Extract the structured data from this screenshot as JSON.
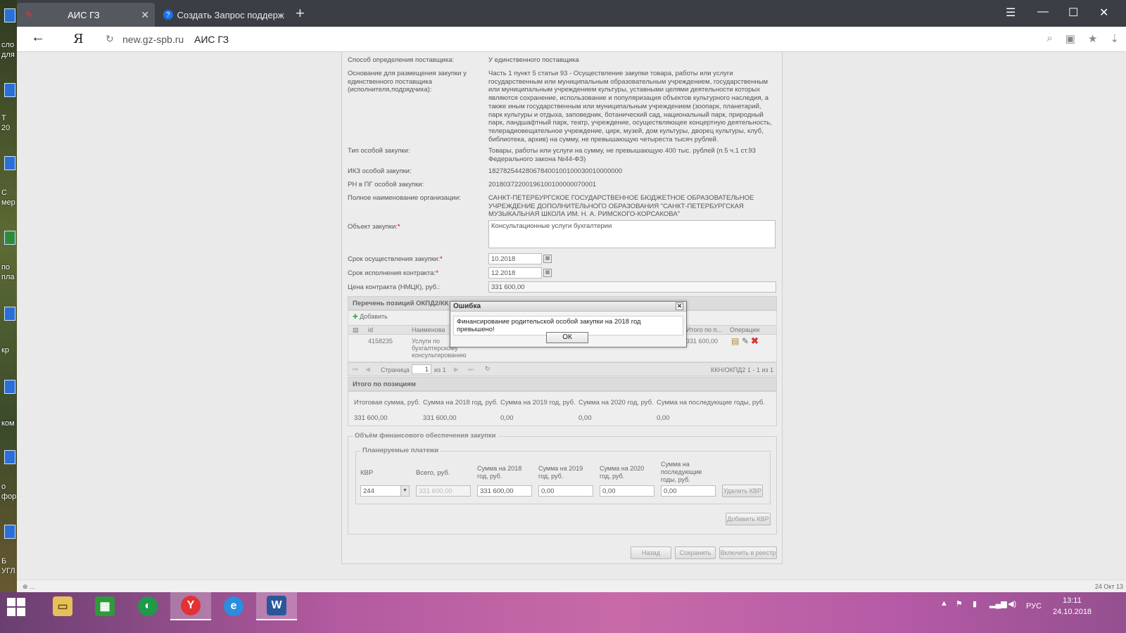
{
  "desktop": {
    "labels": [
      "сло",
      "для",
      "Т",
      "20",
      "С",
      "мер",
      "по",
      "пла",
      "кр",
      "ком",
      "о",
      "фор",
      "Б",
      "УГЛ"
    ]
  },
  "browser": {
    "tabs": [
      {
        "label": "АИС ГЗ",
        "active": true
      },
      {
        "label": "Создать Запрос поддержки",
        "active": false
      }
    ],
    "address": {
      "host": "new.gz-spb.ru",
      "title": "АИС ГЗ"
    },
    "status_left": "⊕ ...",
    "status_right": "24 Окт 13"
  },
  "form": {
    "rows": [
      {
        "label": "Способ определения поставщика:",
        "value": "У единственного поставщика"
      },
      {
        "label": "Основание для размещения закупки у единственного поставщика (исполнителя,подрядчика):",
        "value": "Часть 1 пункт 5 статьи 93 - Осуществление закупки товара, работы или услуги государственным или муниципальным образовательным учреждением, государственным или муниципальным учреждением культуры, уставными целями деятельности которых являются сохранение, использование и популяризация объектов культурного наследия, а также иным государственным или муниципальным учреждением (зоопарк, планетарий, парк культуры и отдыха, заповедник, ботанический сад, национальный парк, природный парк, ландшафтный парк, театр, учреждение, осуществляющее концертную деятельность, телерадиовещательное учреждение, цирк, музей, дом культуры, дворец культуры, клуб, библиотека, архив) на сумму, не превышающую четыреста тысяч рублей."
      },
      {
        "label": "Тип особой закупки:",
        "value": "Товары, работы или услуги на сумму, не превышающую 400 тыс. рублей (п.5 ч.1 ст.93 Федерального закона №44-ФЗ)"
      },
      {
        "label": "ИКЗ особой закупки:",
        "value": "182782544280678400100100030010000000"
      },
      {
        "label": "РН в ПГ особой закупки:",
        "value": "20180372200196100100000070001"
      },
      {
        "label": "Полное наименование организации:",
        "value": "САНКТ-ПЕТЕРБУРГСКОЕ ГОСУДАРСТВЕННОЕ БЮДЖЕТНОЕ ОБРАЗОВАТЕЛЬНОЕ УЧРЕЖДЕНИЕ ДОПОЛНИТЕЛЬНОГО ОБРАЗОВАНИЯ \"САНКТ-ПЕТЕРБУРГСКАЯ МУЗЫКАЛЬНАЯ ШКОЛА ИМ. Н. А. РИМСКОГО-КОРСАКОВА\""
      }
    ],
    "object_label": "Объект закупки:",
    "object_value": "Консультационные услуги бухгалтерии",
    "term_label": "Срок осуществления закупки:",
    "term_value": "10.2018",
    "exec_label": "Срок исполнения контракта:",
    "exec_value": "12.2018",
    "price_label": "Цена контракта (НМЦК), руб.:",
    "price_value": "331 600,00",
    "required_mark": "*"
  },
  "okpd": {
    "header": "Перечень позиций ОКПД2/КК",
    "add_label": "Добавить",
    "columns": {
      "id": "id",
      "name": "Наименова",
      "total": "Итого по п...",
      "ops": "Операции"
    },
    "rows": [
      {
        "id": "4158235",
        "name": "Услуги по бухгалтерскому консультированию",
        "total": "331 600,00"
      }
    ],
    "pager": {
      "page_label": "Страница",
      "page_value": "1",
      "of_label": "из 1",
      "summary": "ККН/ОКПД2 1 - 1 из 1"
    }
  },
  "totals": {
    "header": "Итого по позициям",
    "columns": [
      "Итоговая сумма, руб.",
      "Сумма на 2018 год, руб.",
      "Сумма на 2019 год, руб.",
      "Сумма на 2020 год, руб.",
      "Сумма на последующие годы, руб."
    ],
    "values": [
      "331 600,00",
      "331 600,00",
      "0,00",
      "0,00",
      "0,00"
    ]
  },
  "finance": {
    "legend": "Объём финансового обеспечения закупки",
    "sub_legend": "Планируемые платежи",
    "columns": [
      "КВР",
      "Всего, руб.",
      "Сумма на 2018 год, руб.",
      "Сумма на 2019 год, руб.",
      "Сумма на 2020 год, руб.",
      "Сумма на последующие годы, руб."
    ],
    "kvr_value": "244",
    "total_value": "331 600,00",
    "y2018": "331 600,00",
    "y2019": "0,00",
    "y2020": "0,00",
    "later": "0,00",
    "delete_btn": "Удалить КВР",
    "add_btn": "Добавить КВР"
  },
  "actions": {
    "back": "Назад",
    "save": "Сохранить",
    "include": "Включить в реестр"
  },
  "dialog": {
    "title": "Ошибка",
    "message": "Финансирование родительской особой закупки на 2018 год превышено!",
    "ok": "ОК"
  },
  "taskbar": {
    "apps": [
      "file-explorer",
      "spreadsheet",
      "green-circle-app",
      "yandex-browser",
      "internet-explorer",
      "word"
    ],
    "lang": "РУС",
    "time": "13:11",
    "date": "24.10.2018"
  }
}
